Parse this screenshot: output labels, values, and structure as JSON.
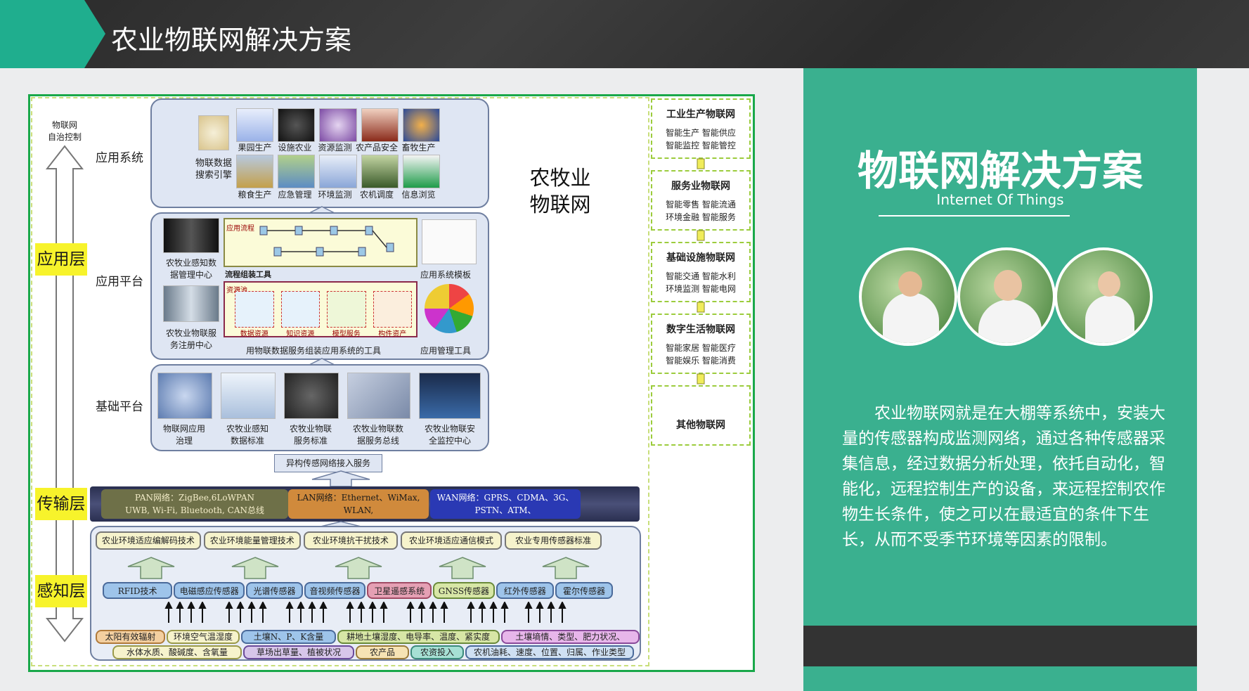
{
  "header": {
    "title": "农业物联网解决方案"
  },
  "diagram": {
    "left_axis_label": "物联网\n自治控制",
    "layers": {
      "application": "应用层",
      "transport": "传输层",
      "perception": "感知层"
    },
    "center_title": "农牧业\n物联网",
    "app_system": {
      "label": "应用系统",
      "search_engine": "物联数据\n搜索引擎",
      "row1": [
        "果园生产",
        "设施农业",
        "资源监测",
        "农产品安全",
        "畜牧生产"
      ],
      "row2": [
        "粮食生产",
        "应急管理",
        "环境监测",
        "农机调度",
        "信息浏览"
      ]
    },
    "app_platform": {
      "label": "应用平台",
      "data_center": "农牧业感知数\n据管理中心",
      "service_center": "农牧业物联服\n务注册中心",
      "process_tool": "流程组装工具",
      "app_template": "应用系统模板",
      "app_manage": "应用管理工具",
      "compose_tool": "用物联数据服务组装应用系统的工具",
      "inner_labels": [
        "应用流程",
        "资源池",
        "数据资源",
        "知识资源",
        "模型服务",
        "构件资产"
      ]
    },
    "base_platform": {
      "label": "基础平台",
      "items": [
        "物联网应用\n治理",
        "农牧业感知\n数据标准",
        "农牧业物联\n服务标准",
        "农牧业物联数\n据服务总线",
        "农牧业物联安\n全监控中心"
      ],
      "access_service": "异构传感网络接入服务"
    },
    "transport": {
      "pan": "PAN网络：ZigBee,6LoWPAN\nUWB, Wi-Fi, Bluetooth, CAN总线",
      "lan": "LAN网络：Ethernet、WiMax,\nWLAN,",
      "wan": "WAN网络：GPRS、CDMA、3G、\nPSTN、ATM、"
    },
    "perception": {
      "techs": [
        "农业环境适应编解码技术",
        "农业环境能量管理技术",
        "农业环境抗干扰技术",
        "农业环境适应通信模式",
        "农业专用传感器标准"
      ],
      "sensors": [
        "RFID技术",
        "电磁感应传感器",
        "光谱传感器",
        "音视频传感器",
        "卫星遥感系统",
        "GNSS传感器",
        "红外传感器",
        "霍尔传感器"
      ],
      "params_row1": [
        "太阳有效辐射",
        "环境空气温湿度",
        "土壤N、P、K含量",
        "耕地土壤湿度、电导率、温度、紧实度",
        "土壤墒情、类型、肥力状况、"
      ],
      "params_row2": [
        "水体水质、酸碱度、含氧量",
        "草场出草量、植被状况",
        "农产品",
        "农资投入",
        "农机油耗、速度、位置、归属、作业类型"
      ]
    },
    "right_column": [
      {
        "title": "工业生产物联网",
        "items": "智能生产  智能供应\n智能监控  智能管控"
      },
      {
        "title": "服务业物联网",
        "items": "智能零售  智能流通\n环境金融  智能服务"
      },
      {
        "title": "基础设施物联网",
        "items": "智能交通  智能水利\n环境监测  智能电网"
      },
      {
        "title": "数字生活物联网",
        "items": "智能家居  智能医疗\n智能娱乐  智能消费"
      },
      {
        "title": "其他物联网",
        "items": ""
      }
    ]
  },
  "side": {
    "title": "物联网解决方案",
    "subtitle": "Internet Of Things",
    "body": "农业物联网就是在大棚等系统中，安装大量的传感器构成监测网络，通过各种传感器采集信息，经过数据分析处理，依托自动化，智能化，远程控制生产的设备，来远程控制农作物生长条件，使之可以在最适宜的条件下生长，从而不受季节环境等因素的限制。"
  },
  "colors": {
    "accent": "#3ab08f",
    "title_bar": "#2f2f2f",
    "layer_label": "#f7f32b",
    "diagram_border": "#19a84a"
  }
}
